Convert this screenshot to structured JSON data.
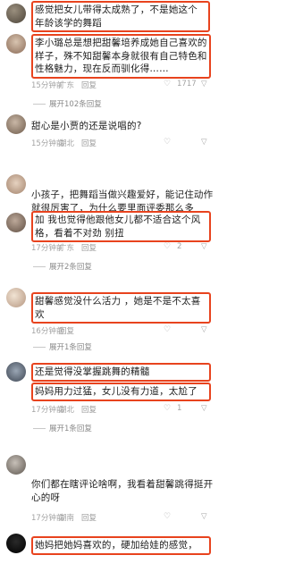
{
  "comments": [
    {
      "id": "c1",
      "text": "感觉把女儿带得太成熟了，不是她这个年龄该学的舞蹈",
      "highlighted": true
    },
    {
      "id": "c2",
      "text": "李小璐总是想把甜馨培养成她自己喜欢的样子，殊不知甜馨本身就很有自己特色和性格魅力，现在反而驯化得……",
      "highlighted": true,
      "meta": {
        "time": "15分钟前",
        "location": "广东",
        "reply": "回复",
        "likes": "1717"
      },
      "expand": "展开102条回复"
    },
    {
      "id": "c3",
      "text": "甜心是小贾的还是说唱的?",
      "highlighted": false,
      "meta": {
        "time": "15分钟前",
        "location": "湖北",
        "reply": "回复",
        "likes": ""
      }
    },
    {
      "id": "c4",
      "text": "小孩子，把舞蹈当做兴趣爱好，能记住动作就很厉害了，为什么要里面评委那么多",
      "highlighted": false
    },
    {
      "id": "c5",
      "text": "加 我也觉得他跟他女儿都不适合这个风格，看着不对劲 别扭",
      "highlighted": true,
      "meta": {
        "time": "17分钟前",
        "location": "广东",
        "reply": "回复",
        "likes": "2"
      },
      "expand": "展开2条回复"
    },
    {
      "id": "c6",
      "text": "甜馨感觉没什么活力 ，她是不是不太喜欢",
      "highlighted": true,
      "meta": {
        "time": "16分钟前",
        "location": "",
        "reply": "回复",
        "likes": ""
      },
      "expand": "展开1条回复"
    },
    {
      "id": "c7",
      "text": "还是觉得没掌握跳舞的精髓",
      "highlighted": true
    },
    {
      "id": "c8",
      "text": "妈妈用力过猛，女儿没有力道，太尬了",
      "highlighted": true,
      "meta": {
        "time": "17分钟前",
        "location": "湖北",
        "reply": "回复",
        "likes": "1"
      },
      "expand": "展开1条回复"
    },
    {
      "id": "c9",
      "text": "你们都在瞎评论啥啊，我看着甜馨跳得挺开心的呀",
      "highlighted": false,
      "meta": {
        "time": "17分钟前",
        "location": "湖南",
        "reply": "回复",
        "likes": ""
      }
    },
    {
      "id": "c10",
      "text": "她妈把她妈喜欢的，硬加给娃的感觉，",
      "highlighted": true
    }
  ],
  "icons": {
    "like": "heart-outline-icon",
    "dislike": "thumb-down-icon",
    "emoji": "grinning-sweat-emoji",
    "blue": "blue-emoji"
  },
  "colors": {
    "highlight": "#e8431e",
    "meta": "#a3a3a3"
  }
}
